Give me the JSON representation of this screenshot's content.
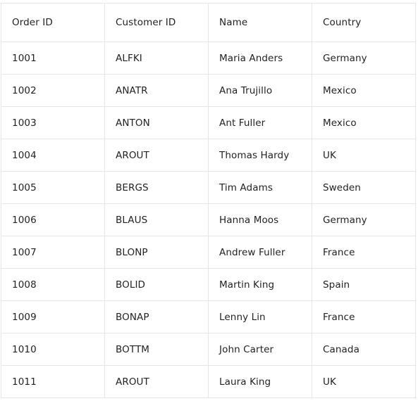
{
  "grid": {
    "columns": [
      "Order ID",
      "Customer ID",
      "Name",
      "Country"
    ],
    "rows": [
      [
        "1001",
        "ALFKI",
        "Maria Anders",
        "Germany"
      ],
      [
        "1002",
        "ANATR",
        "Ana Trujillo",
        "Mexico"
      ],
      [
        "1003",
        "ANTON",
        "Ant Fuller",
        "Mexico"
      ],
      [
        "1004",
        "AROUT",
        "Thomas Hardy",
        "UK"
      ],
      [
        "1005",
        "BERGS",
        "Tim Adams",
        "Sweden"
      ],
      [
        "1006",
        "BLAUS",
        "Hanna Moos",
        "Germany"
      ],
      [
        "1007",
        "BLONP",
        "Andrew Fuller",
        "France"
      ],
      [
        "1008",
        "BOLID",
        "Martin King",
        "Spain"
      ],
      [
        "1009",
        "BONAP",
        "Lenny Lin",
        "France"
      ],
      [
        "1010",
        "BOTTM",
        "John Carter",
        "Canada"
      ],
      [
        "1011",
        "AROUT",
        "Laura King",
        "UK"
      ]
    ]
  }
}
